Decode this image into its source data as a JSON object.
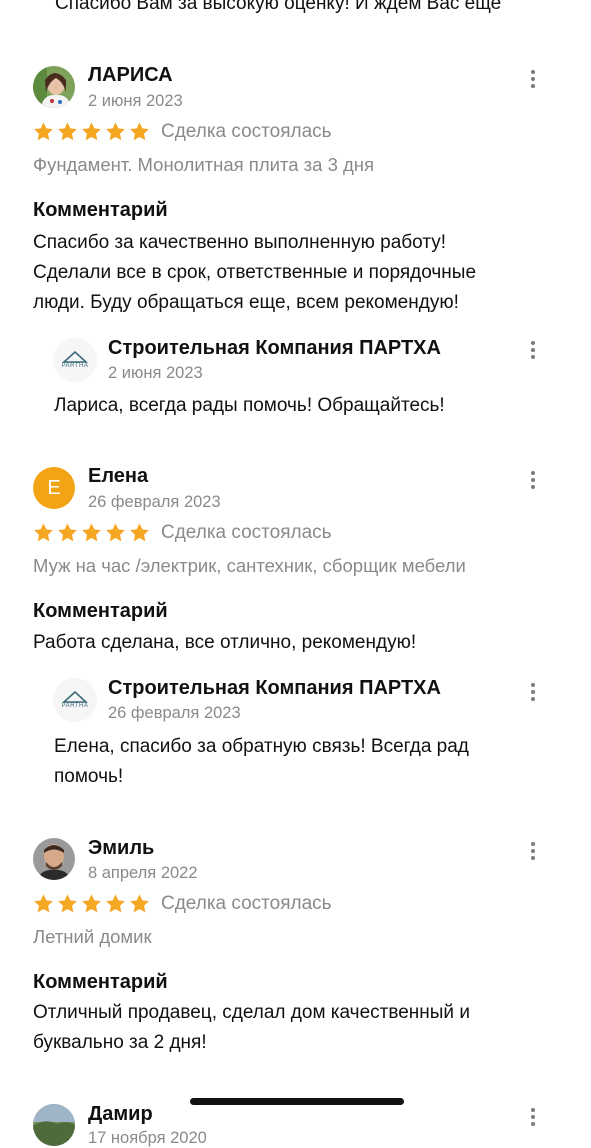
{
  "top_cut_text": "Спасибо Вам за высокую оценку! И ждем Вас еще",
  "reviews": [
    {
      "name": "ЛАРИСА",
      "date": "2 июня 2023",
      "rating": 5,
      "status": "Сделка состоялась",
      "service": "Фундамент. Монолитная плита за 3 дня",
      "comment_heading": "Комментарий",
      "comment_lines": [
        "Спасибо за качественно выполненную работу!",
        "Сделали все в срок, ответственные и порядочные",
        "люди. Буду обращаться еще, всем рекомендую!"
      ],
      "reply": {
        "logo_text": "PARTHA",
        "company": "Строительная Компания ПАРТХА",
        "date": "2 июня 2023",
        "lines": [
          "Лариса, всегда рады помочь! Обращайтесь!"
        ]
      }
    },
    {
      "name": "Елена",
      "avatar_letter": "Е",
      "date": "26 февраля 2023",
      "rating": 5,
      "status": "Сделка состоялась",
      "service": "Муж на час /электрик, сантехник, сборщик мебели",
      "comment_heading": "Комментарий",
      "comment_lines": [
        "Работа сделана, все отлично, рекомендую!"
      ],
      "reply": {
        "logo_text": "PARTHA",
        "company": "Строительная Компания ПАРТХА",
        "date": "26 февраля 2023",
        "lines": [
          "Елена, спасибо за обратную связь! Всегда рад",
          "помочь!"
        ]
      }
    },
    {
      "name": "Эмиль",
      "date": "8 апреля 2022",
      "rating": 5,
      "status": "Сделка состоялась",
      "service": "Летний домик",
      "comment_heading": "Комментарий",
      "comment_lines": [
        "Отличный продавец, сделал дом качественный и",
        "буквально за 2 дня!"
      ]
    },
    {
      "name": "Дамир",
      "date": "17 ноября 2020"
    }
  ],
  "colors": {
    "star": "#f5a623",
    "muted": "#8a8a8a",
    "avatar_orange": "#f2a414"
  },
  "icons": {
    "kebab": "more-vertical-icon",
    "star": "star-icon"
  }
}
